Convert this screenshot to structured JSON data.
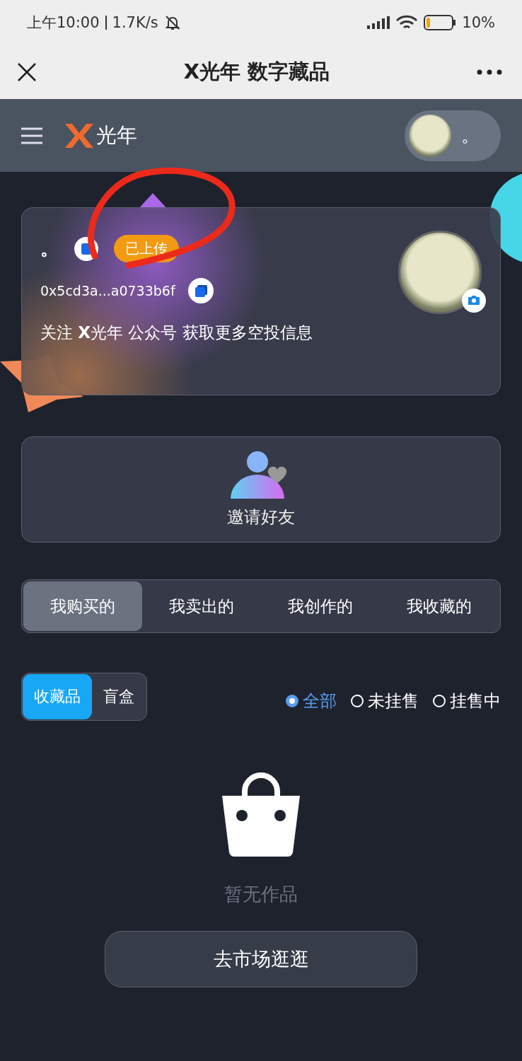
{
  "status_bar": {
    "time": "上午10:00",
    "speed": "1.7K/s",
    "battery": "10%"
  },
  "title_bar": {
    "title": "X光年 数字藏品"
  },
  "header": {
    "logo_text": "光年",
    "user_name": "。"
  },
  "profile": {
    "name": "。",
    "badge": "已上传",
    "address": "0x5cd3a...a0733b6f",
    "notice": "关注 **X**光年 公众号 获取更多空投信息"
  },
  "invite": {
    "label": "邀请好友"
  },
  "tabs": [
    {
      "label": "我购买的",
      "selected": true
    },
    {
      "label": "我卖出的",
      "selected": false
    },
    {
      "label": "我创作的",
      "selected": false
    },
    {
      "label": "我收藏的",
      "selected": false
    }
  ],
  "type_tabs": [
    {
      "label": "收藏品",
      "selected": true
    },
    {
      "label": "盲盒",
      "selected": false
    }
  ],
  "filters": [
    {
      "label": "全部",
      "selected": true
    },
    {
      "label": "未挂售",
      "selected": false
    },
    {
      "label": "挂售中",
      "selected": false
    }
  ],
  "empty": {
    "message": "暂无作品",
    "button": "去市场逛逛"
  }
}
